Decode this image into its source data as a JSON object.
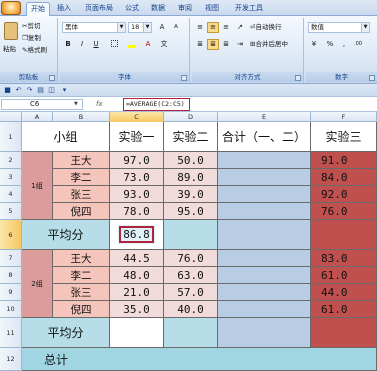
{
  "tabs": [
    "开始",
    "插入",
    "页面布局",
    "公式",
    "数据",
    "审阅",
    "视图",
    "开发工具"
  ],
  "active_tab": "开始",
  "ribbon": {
    "clipboard": {
      "paste": "粘贴",
      "cut": "剪切",
      "copy": "复制",
      "format_painter": "格式刷",
      "label": "剪贴板"
    },
    "font": {
      "name": "黑体",
      "size": "18",
      "label": "字体",
      "bold": "B",
      "italic": "I",
      "underline": "U",
      "font_color_glyph": "A"
    },
    "alignment": {
      "wrap": "自动换行",
      "merge": "合并后居中",
      "label": "对齐方式"
    },
    "number": {
      "format": "数值",
      "percent": "%",
      "comma": ",",
      "label": "数字"
    }
  },
  "formula_bar": {
    "name_box": "C6",
    "fx": "fx",
    "formula": "=AVERAGE(C2:C5)"
  },
  "columns": [
    "A",
    "B",
    "C",
    "D",
    "E",
    "F"
  ],
  "row_numbers": [
    "1",
    "2",
    "3",
    "4",
    "5",
    "6",
    "7",
    "8",
    "9",
    "10",
    "11",
    "12"
  ],
  "headers": {
    "group": "小组",
    "exp1": "实验一",
    "exp2": "实验二",
    "total": "合计（一、二）",
    "exp3": "实验三"
  },
  "group1": {
    "label": "1组",
    "members": [
      {
        "name": "王大",
        "exp1": "97.0",
        "exp2": "50.0",
        "exp3": "91.0"
      },
      {
        "name": "李二",
        "exp1": "73.0",
        "exp2": "89.0",
        "exp3": "84.0"
      },
      {
        "name": "张三",
        "exp1": "93.0",
        "exp2": "39.0",
        "exp3": "92.0"
      },
      {
        "name": "倪四",
        "exp1": "78.0",
        "exp2": "95.0",
        "exp3": "76.0"
      }
    ]
  },
  "avg_label": "平均分",
  "avg_value": "86.8",
  "group2": {
    "label": "2组",
    "members": [
      {
        "name": "王大",
        "exp1": "44.5",
        "exp2": "76.0",
        "exp3": "83.0"
      },
      {
        "name": "李二",
        "exp1": "48.0",
        "exp2": "63.0",
        "exp3": "61.0"
      },
      {
        "name": "张三",
        "exp1": "21.0",
        "exp2": "57.0",
        "exp3": "44.0"
      },
      {
        "name": "倪四",
        "exp1": "35.0",
        "exp2": "40.0",
        "exp3": "61.0"
      }
    ]
  },
  "avg_label_2": "平均分",
  "total_label": "总计",
  "colors": {
    "selection_outline": "#b2223a",
    "group_pink": "#dc9c9c",
    "exp3_red": "#c0504d",
    "avg_blue": "#b7dde8"
  }
}
